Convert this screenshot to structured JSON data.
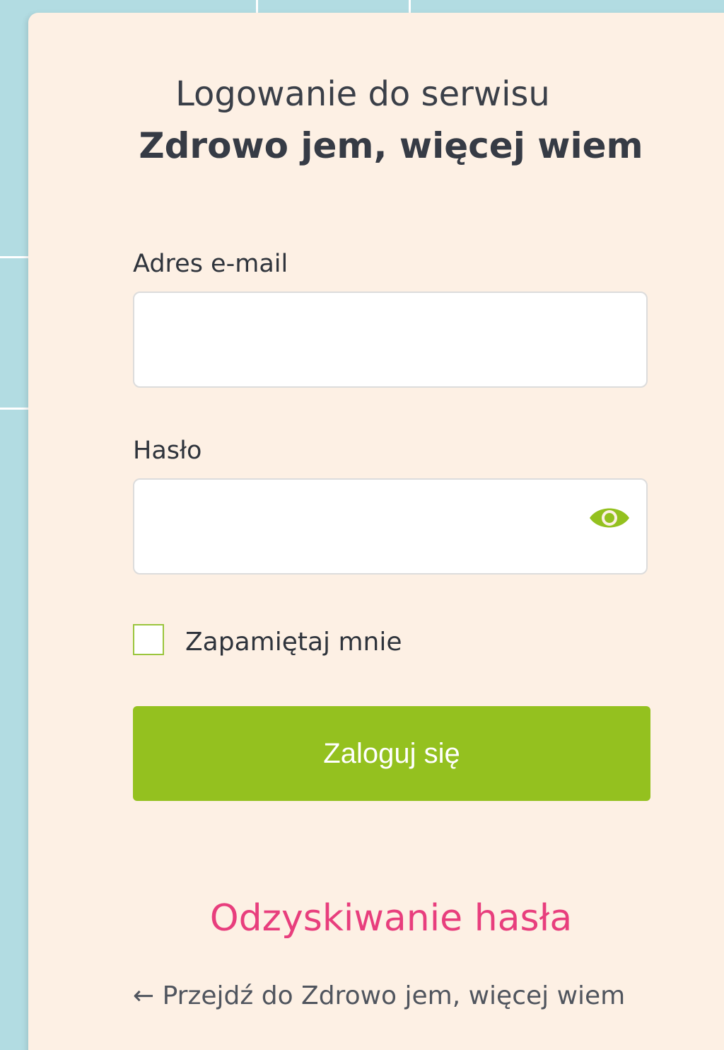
{
  "login": {
    "title_line1": "Logowanie do serwisu",
    "title_line2": "Zdrowo jem, więcej wiem",
    "email": {
      "label": "Adres e-mail",
      "value": ""
    },
    "password": {
      "label": "Hasło",
      "value": "",
      "toggle_icon": "eye-icon"
    },
    "remember": {
      "label": "Zapamiętaj mnie",
      "checked": false
    },
    "submit_label": "Zaloguj się",
    "recover_link": "Odzyskiwanie hasła",
    "back_link": "← Przejdź do Zdrowo jem, więcej wiem"
  },
  "colors": {
    "background": "#b2dce2",
    "card": "#fdf0e4",
    "accent_green": "#94c11f",
    "link_pink": "#e83e7d",
    "text_dark": "#363b45"
  }
}
